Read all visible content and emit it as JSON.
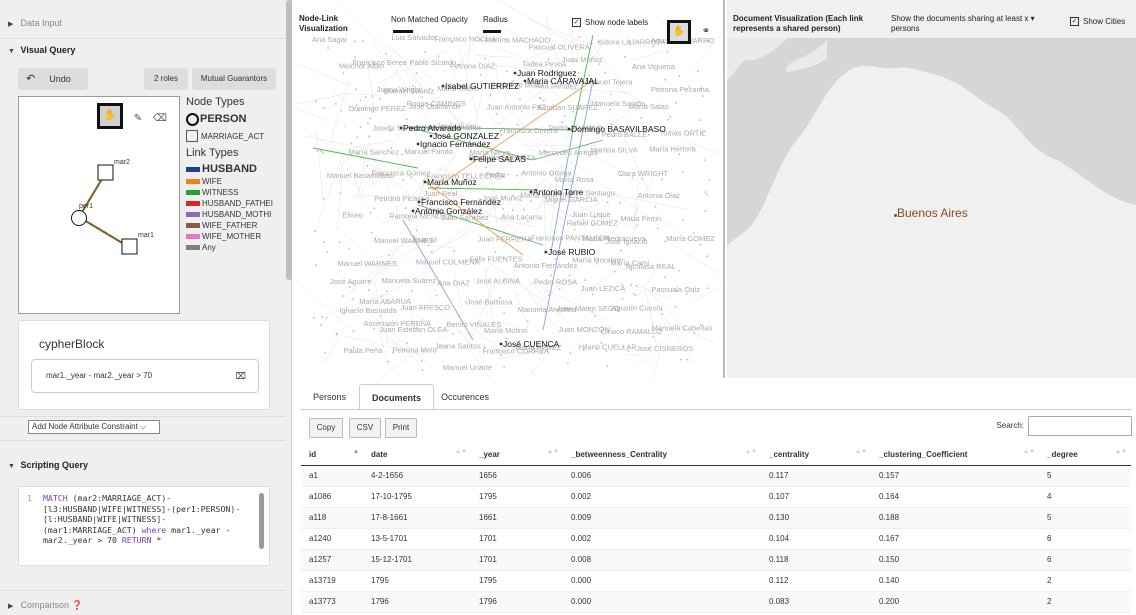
{
  "left": {
    "data_input": "Data Input",
    "visual_query": "Visual Query",
    "undo": "Undo",
    "roles": "2 roles",
    "mutual": "Mutual Guarantors",
    "node_types_title": "Node Types",
    "node_types": [
      "PERSON",
      "MARRIAGE_ACT"
    ],
    "link_types_title": "Link Types",
    "link_types": [
      {
        "label": "HUSBAND",
        "color": "#1f3f8f"
      },
      {
        "label": "WIFE",
        "color": "#f07f20"
      },
      {
        "label": "WITNESS",
        "color": "#2aa02a"
      },
      {
        "label": "HUSBAND_FATHEI",
        "color": "#d62728"
      },
      {
        "label": "HUSBAND_MOTHI",
        "color": "#9467bd"
      },
      {
        "label": "WIFE_FATHER",
        "color": "#8c564b"
      },
      {
        "label": "WIFE_MOTHER",
        "color": "#e377c2"
      },
      {
        "label": "Any",
        "color": "#7f7f7f"
      }
    ],
    "query_nodes": [
      "mar2",
      "per1",
      "mar1"
    ],
    "cypher_title": "cypherBlock",
    "constraint": "mar1._year - mar2._year > 70",
    "add_constraint": "Add Node Attribute Constraint ⌵",
    "scripting_query": "Scripting Query",
    "code_line_no": "1",
    "code_kw1": "MATCH",
    "code_a": " (mar2:MARRIAGE_ACT)-[l3:HUSBAND|WIFE|WITNESS]-(per1:PERSON)-[l:HUSBAND|WIFE|WITNESS]-(mar1:MARRIAGE_ACT) ",
    "code_kw2": "where",
    "code_b": " mar1._year - mar2._year > 70 ",
    "code_kw3": "RETURN",
    "code_c": " *",
    "comparison": "Comparison ❓"
  },
  "network": {
    "title": "Node-Link Visualization",
    "opacity_label": "Non Matched Opacity",
    "radius_label": "Radius",
    "show_labels": "Show node labels",
    "bold_labels": [
      "Juan Rodriguez",
      "Maria CARAVAJAL",
      "Isabel GUTIERREZ",
      "Pedro Alvarado",
      "Domingo BASAVILBASO",
      "José GONZALEZ",
      "Felipe SALAS",
      "Ignacio Fernández",
      "María Muñoz",
      "Antonio Torre",
      "Francisco Fernández",
      "Antonio González",
      "José RUBIO",
      "José CUENCA"
    ],
    "faded_labels": [
      "Ana Sagar",
      "Luis Salvador",
      "Francisco HOCHA",
      "Martina MACHADO",
      "Pascual OLIVERA",
      "Isidora LAJARROTA",
      "Agustín NAVARRO",
      "Francisco Berea",
      "Pablo Sicardo",
      "Petrona DIAZ",
      "Tadea Pesoa",
      "Juan Muñoz",
      "Ana Vigueria",
      "Melchor Albin",
      "Manuel Suárez",
      "María Tolero",
      "Jerónimo Mons",
      "Ana Mendez",
      "Manuel Tejera",
      "Petrona Pecanha",
      "Juana Wright",
      "Roque CAMINOS",
      "Juan Antonio PAZ",
      "Esteban SUAREZ",
      "Manuela Santos",
      "María Salas",
      "Domingo PEREZ",
      "José Otamendi",
      "José Urizar",
      "Francisca Olivera",
      "Pedro FRANCO",
      "Pedro BALLE",
      "Tomás ORTIZ",
      "Josefa Silva",
      "José Bustamante",
      "María Nieva",
      "Mercedes Arregui",
      "Martina SILVA",
      "María Herrera",
      "María Sanchez",
      "Manuel Pando",
      "Bernarda ESPARZA",
      "Antonio Ortega",
      "María Rosa",
      "Clara WRIGHT",
      "Manuel Basavilbaso",
      "Francisca Gómez",
      "Francisco TELLECHEA",
      "Pedro",
      "Miguel GARCIA",
      "Santiago",
      "Antonia Diaz",
      "Petrona Picavea",
      "Juan Real",
      "José Muñoz",
      "María MARTINEZ",
      "Juan Luque",
      "María Ferrin",
      "Eliseo",
      "Ramona MENDEZ",
      "Juan Sánchez",
      "Ana Lacarra",
      "Rafael GOMEZ",
      "José Ignacio",
      "María GOMEZ",
      "Manuel WARNES",
      "Juan M",
      "Juan FERRERA",
      "Francisco PANTALEON",
      "María Piedracueva",
      "Nicolasa REAL",
      "Manuel WARNES",
      "Manuel COLMENA",
      "Félix FUENTES",
      "Antonio Fernández",
      "María Morales",
      "María Cami",
      "José Aguirre",
      "Manuela Suárez",
      "Ana DIAZ",
      "José ALSINA",
      "Pedro ROSA",
      "Juan LEZICA",
      "Pascuala Ortiz",
      "María ABARUA",
      "Juan FRESCO",
      "José Barbosa",
      "Manuela Arechea",
      "Juan Mateo SEGO",
      "Agustín Cuesta",
      "Ignacio Basualdo",
      "Juan Esteban OLEA",
      "Benito VIÑALES",
      "María Molino",
      "Juan MONZÓN",
      "Ciriaco RAMALLO",
      "Manuela Cabeñas",
      "Ascensión PEREÑA",
      "Juana Santos",
      "Francisco CORREA",
      "María PEREZ",
      "Hilario CUELLAR",
      "José CISNEROS",
      "Paula Peña",
      "Petrona Melo",
      "Manuel Uriarte"
    ]
  },
  "map": {
    "title": "Document Visualization (Each link represents a shared person)",
    "share_label": "Show the documents sharing at least x ▾ persons",
    "show_cities": "Show Cities",
    "city": "Buenos Aires",
    "colors": {
      "land": "#f0f0f0",
      "water": "#d6d6d6",
      "city": "#8a4a22"
    }
  },
  "tables": {
    "tabs": [
      "Persons",
      "Documents",
      "Occurences"
    ],
    "active_tab": "Documents",
    "buttons": [
      "Copy",
      "CSV",
      "Print"
    ],
    "search_label": "Search:",
    "columns": [
      "id",
      "date",
      "_year",
      "_betweenness_Centrality",
      "_centrality",
      "_clustering_Coefficient",
      "_degree"
    ],
    "rows": [
      [
        "a1",
        "4-2-1656",
        "1656",
        "0.006",
        "0.117",
        "0.157",
        "5"
      ],
      [
        "a1086",
        "17-10-1795",
        "1795",
        "0.002",
        "0.107",
        "0.164",
        "4"
      ],
      [
        "a118",
        "17-8-1661",
        "1661",
        "0.009",
        "0.130",
        "0.188",
        "5"
      ],
      [
        "a1240",
        "13-5-1701",
        "1701",
        "0.002",
        "0.104",
        "0.167",
        "6"
      ],
      [
        "a1257",
        "15-12-1701",
        "1701",
        "0.008",
        "0.118",
        "0.150",
        "6"
      ],
      [
        "a13719",
        "1795",
        "1795",
        "0.000",
        "0.112",
        "0.140",
        "2"
      ],
      [
        "a13773",
        "1796",
        "1796",
        "0.000",
        "0.083",
        "0.200",
        "2"
      ]
    ]
  }
}
